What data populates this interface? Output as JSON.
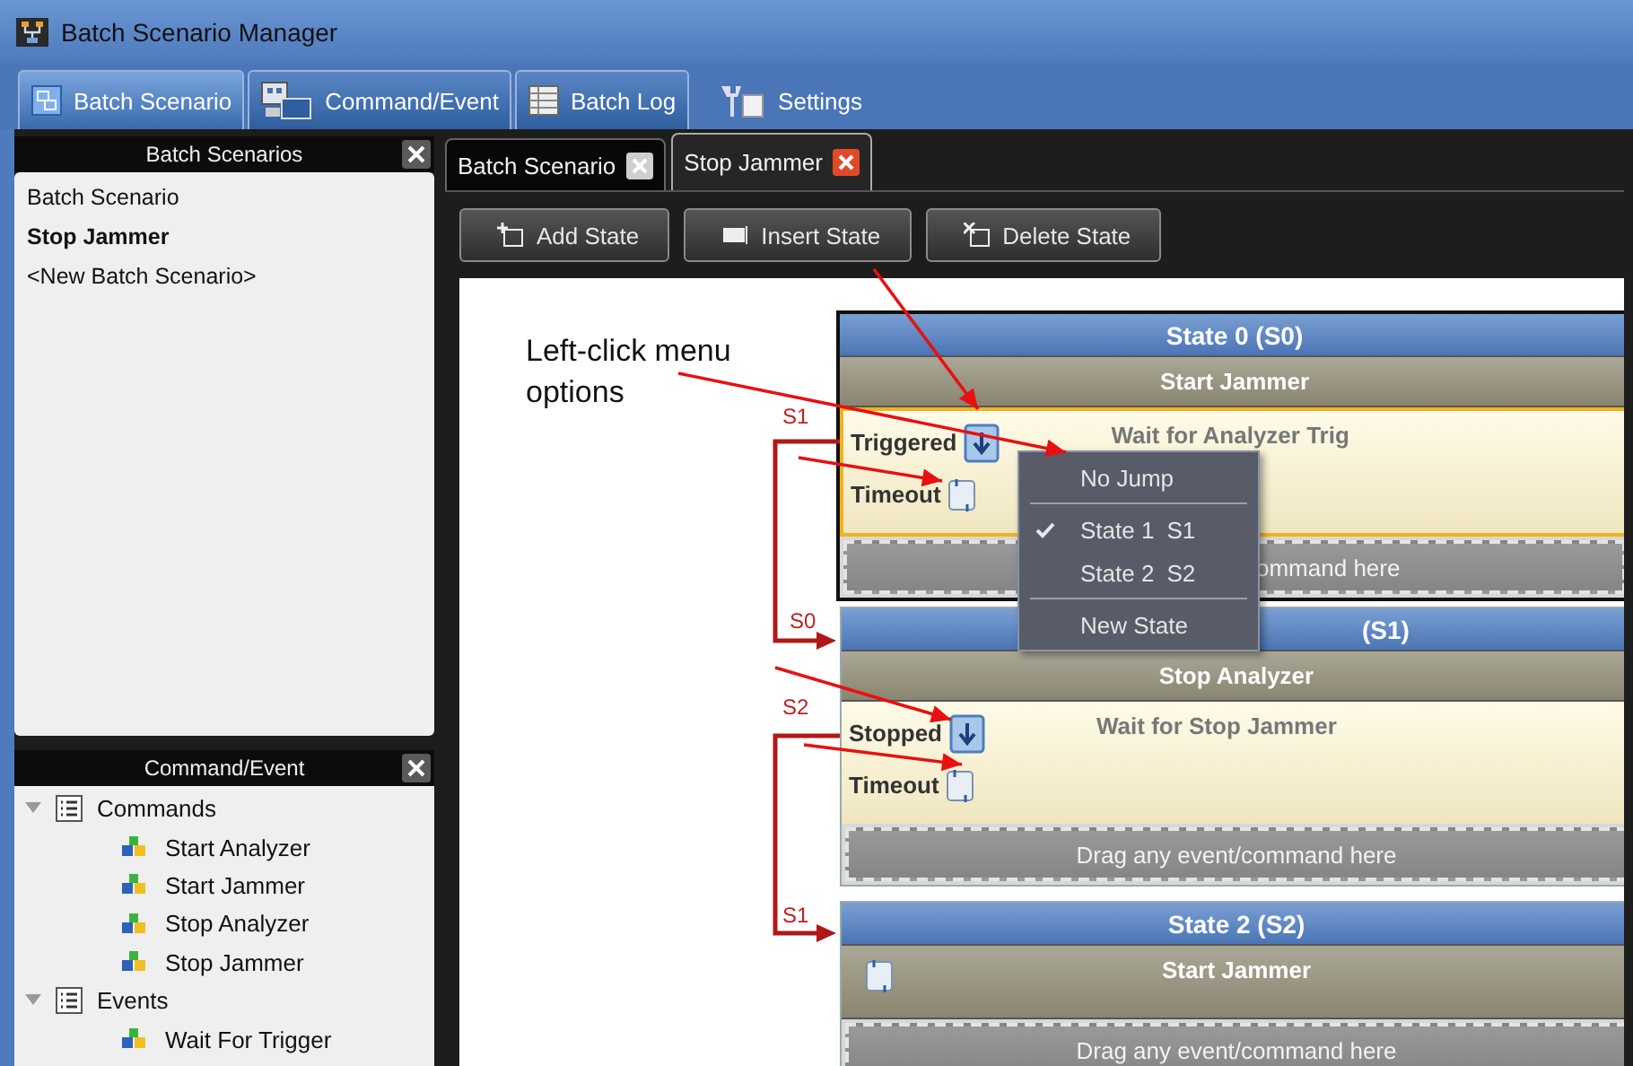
{
  "window": {
    "title": "Batch Scenario Manager"
  },
  "main_tabs": [
    {
      "label": "Batch Scenario",
      "selected": true
    },
    {
      "label": "Command/Event",
      "selected": false
    },
    {
      "label": "Batch Log",
      "selected": false
    }
  ],
  "settings_button": {
    "label": "Settings"
  },
  "scenarios_panel": {
    "title": "Batch Scenarios",
    "items": [
      {
        "label": "Batch Scenario",
        "selected": false
      },
      {
        "label": "Stop Jammer",
        "selected": true
      },
      {
        "label": "<New Batch Scenario>",
        "selected": false
      }
    ]
  },
  "command_event_panel": {
    "title": "Command/Event",
    "tree": [
      {
        "label": "Commands",
        "expanded": true,
        "children": [
          {
            "label": "Start Analyzer"
          },
          {
            "label": "Start Jammer"
          },
          {
            "label": "Stop Analyzer"
          },
          {
            "label": "Stop Jammer"
          }
        ]
      },
      {
        "label": "Events",
        "expanded": true,
        "children": [
          {
            "label": "Wait For Trigger"
          }
        ]
      }
    ]
  },
  "document_tabs": [
    {
      "label": "Batch Scenario",
      "selected": false
    },
    {
      "label": "Stop Jammer",
      "selected": true
    }
  ],
  "toolbar": [
    {
      "label": "Add State",
      "kind": "add"
    },
    {
      "label": "Insert State",
      "kind": "insert"
    },
    {
      "label": "Delete State",
      "kind": "delete"
    }
  ],
  "annotation": {
    "text": "Left-click menu options"
  },
  "states": [
    {
      "title": "State 0 (S0)",
      "title_partial": false,
      "selected": true,
      "command": "Start Jammer",
      "timeout_icon": false,
      "events": [
        {
          "label": "Triggered",
          "highlighted": true
        },
        {
          "label": "Timeout",
          "highlighted": false
        }
      ],
      "event_name": "Wait for Analyzer Trig",
      "drop_hint": "ommand here",
      "drop_hint_partial": true
    },
    {
      "title": "(S1)",
      "title_partial": true,
      "selected": false,
      "command": "Stop Analyzer",
      "timeout_icon": false,
      "events": [
        {
          "label": "Stopped",
          "highlighted": true
        },
        {
          "label": "Timeout",
          "highlighted": false
        }
      ],
      "event_name": "Wait for Stop Jammer",
      "drop_hint": "Drag any event/command here",
      "drop_hint_partial": false
    },
    {
      "title": "State 2 (S2)",
      "title_partial": false,
      "selected": false,
      "command": "Start Jammer",
      "timeout_icon": true,
      "drop_hint": "Drag any event/command here",
      "drop_hint_partial": false
    }
  ],
  "jumps": [
    {
      "top_label": "S1",
      "bottom_label": "S0"
    },
    {
      "top_label": "S2",
      "bottom_label": "S1"
    }
  ],
  "context_menu": {
    "items": [
      {
        "kind": "item",
        "label": "No Jump",
        "checked": false
      },
      {
        "kind": "separator"
      },
      {
        "kind": "item",
        "label": "State 1",
        "shortcut": "S1",
        "checked": true
      },
      {
        "kind": "item",
        "label": "State 2",
        "shortcut": "S2",
        "checked": false
      },
      {
        "kind": "separator"
      },
      {
        "kind": "item",
        "label": "New State",
        "checked": false
      }
    ]
  }
}
